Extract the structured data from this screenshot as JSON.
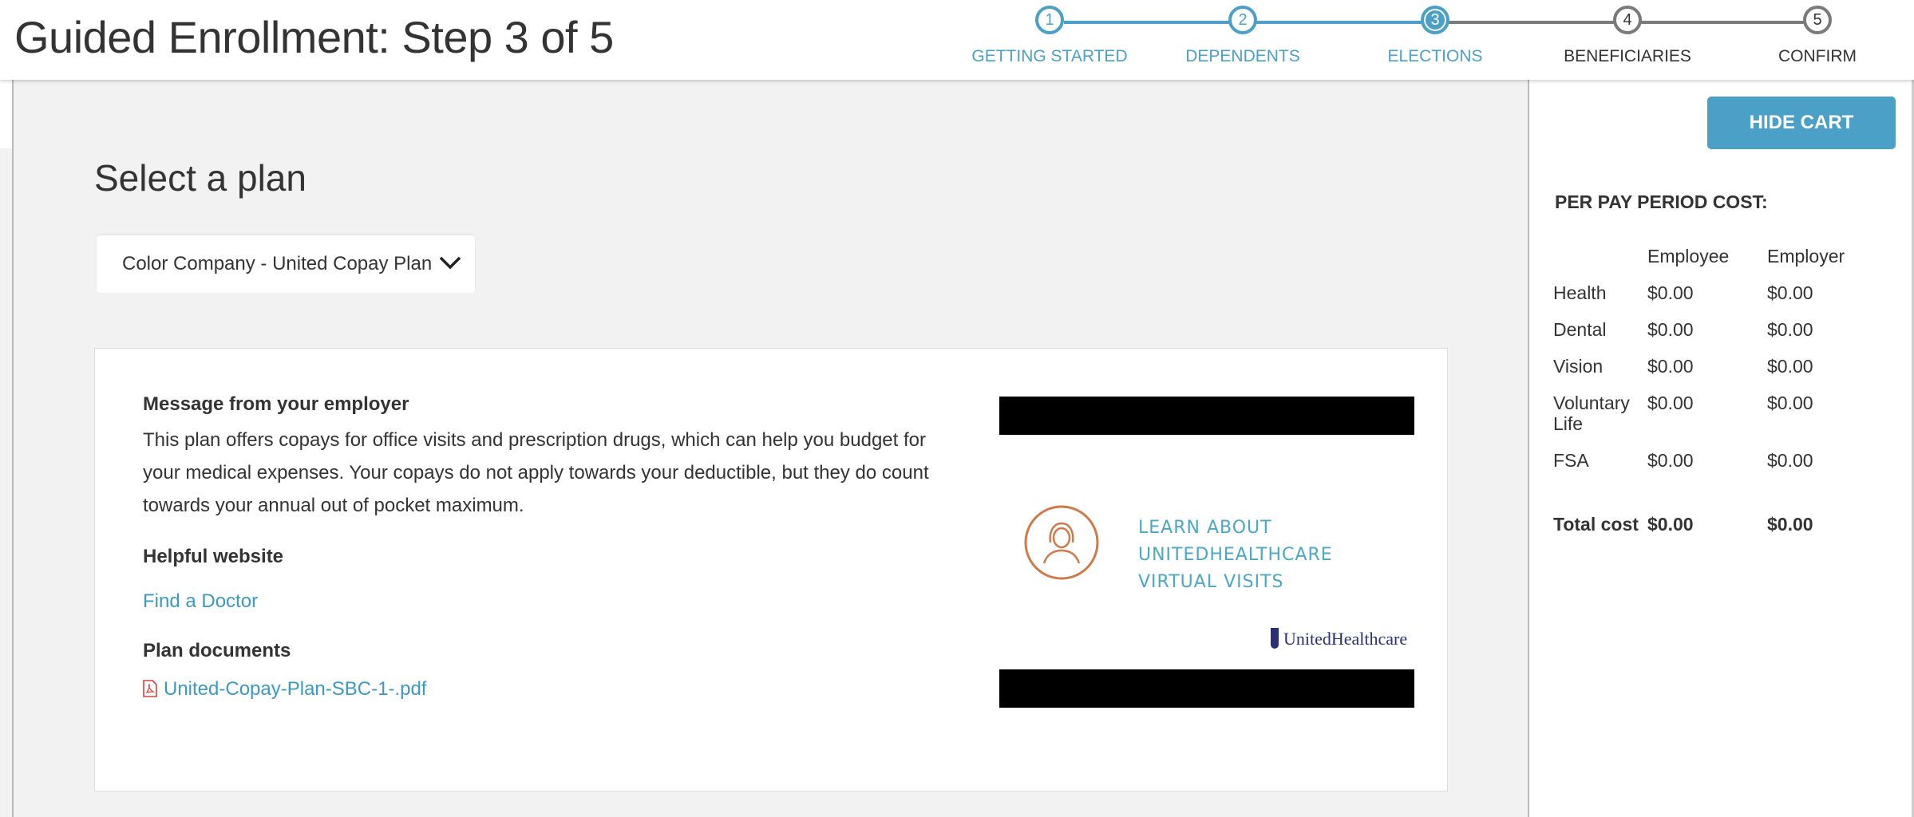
{
  "header": {
    "title": "Guided Enrollment: Step 3 of 5"
  },
  "stepper": {
    "steps": [
      {
        "number": "1",
        "label": "GETTING STARTED",
        "state": "completed"
      },
      {
        "number": "2",
        "label": "DEPENDENTS",
        "state": "completed"
      },
      {
        "number": "3",
        "label": "ELECTIONS",
        "state": "active"
      },
      {
        "number": "4",
        "label": "BENEFICIARIES",
        "state": "future"
      },
      {
        "number": "5",
        "label": "CONFIRM",
        "state": "future"
      }
    ],
    "accent_color": "#4aa0c6"
  },
  "main": {
    "section_title": "Select a plan",
    "plan_select": {
      "value": "Color Company - United Copay Plan"
    },
    "card": {
      "message_heading": "Message from your employer",
      "message_text": "This plan offers copays for office visits and prescription drugs, which can help you budget for your medical expenses. Your copays do not apply towards your deductible, but they do count towards your annual out of pocket maximum.",
      "website_heading": "Helpful website",
      "website_link": "Find a Doctor",
      "documents_heading": "Plan documents",
      "document_link": "United-Copay-Plan-SBC-1-.pdf",
      "media": {
        "lines": [
          "LEARN ABOUT",
          "UNITEDHEALTHCARE",
          "VIRTUAL VISITS"
        ],
        "logo_text": "UnitedHealthcare"
      }
    }
  },
  "cart": {
    "hide_button": "HIDE CART",
    "title": "PER PAY PERIOD COST:",
    "columns": [
      "",
      "Employee",
      "Employer"
    ],
    "rows": [
      {
        "label": "Health",
        "employee": "$0.00",
        "employer": "$0.00"
      },
      {
        "label": "Dental",
        "employee": "$0.00",
        "employer": "$0.00"
      },
      {
        "label": "Vision",
        "employee": "$0.00",
        "employer": "$0.00"
      },
      {
        "label": "Voluntary Life",
        "employee": "$0.00",
        "employer": "$0.00"
      },
      {
        "label": "FSA",
        "employee": "$0.00",
        "employer": "$0.00"
      }
    ],
    "total": {
      "label": "Total cost",
      "employee": "$0.00",
      "employer": "$0.00"
    }
  }
}
